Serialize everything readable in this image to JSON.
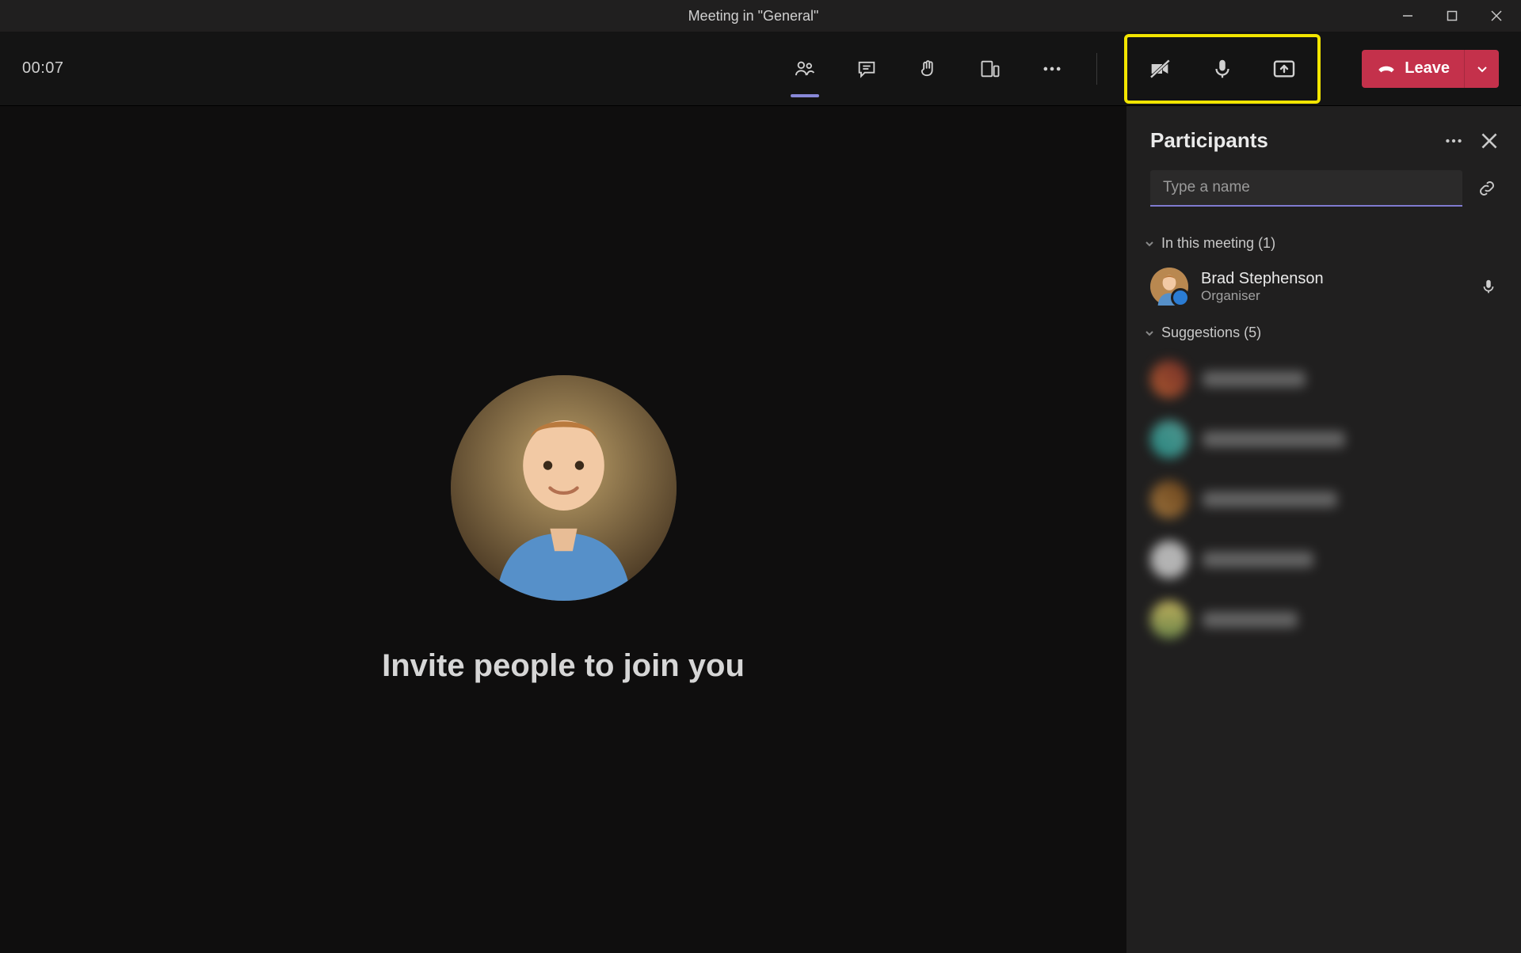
{
  "title_bar": {
    "title": "Meeting in \"General\""
  },
  "toolbar": {
    "timer": "00:07",
    "leave_label": "Leave"
  },
  "stage": {
    "invite_text": "Invite people to join you"
  },
  "panel": {
    "title": "Participants",
    "search_placeholder": "Type a name",
    "sections": {
      "in_meeting": {
        "label": "In this meeting (1)",
        "items": [
          {
            "name": "Brad Stephenson",
            "role": "Organiser"
          }
        ]
      },
      "suggestions": {
        "label": "Suggestions (5)"
      }
    }
  },
  "colors": {
    "leave_button": "#c4314b",
    "highlight_border": "#f2e500",
    "accent_underline": "#807bd0"
  }
}
